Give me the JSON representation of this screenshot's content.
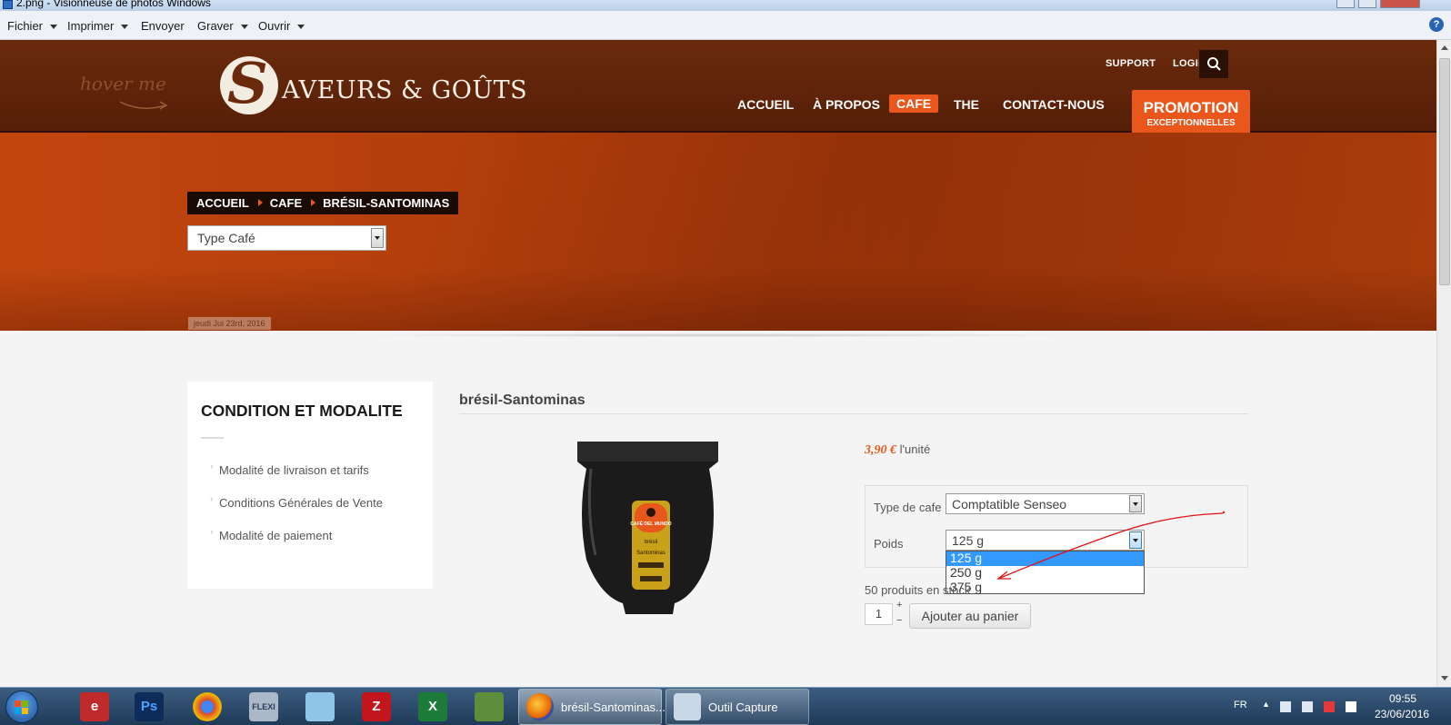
{
  "window": {
    "title": "2.png - Visionneuse de photos Windows"
  },
  "menubar": {
    "items": [
      {
        "label": "Fichier",
        "has_caret": true
      },
      {
        "label": "Imprimer",
        "has_caret": true
      },
      {
        "label": "Envoyer",
        "has_caret": false
      },
      {
        "label": "Graver",
        "has_caret": true
      },
      {
        "label": "Ouvrir",
        "has_caret": true
      }
    ],
    "help": "?"
  },
  "site": {
    "hover_me": "hover me",
    "logo_text": "AVEURS & GOÛTS",
    "top_links": {
      "support": "SUPPORT",
      "login": "LOGIN"
    },
    "nav": [
      {
        "label": "ACCUEIL",
        "active": false
      },
      {
        "label": "À PROPOS",
        "active": false
      },
      {
        "label": "CAFE",
        "active": true
      },
      {
        "label": "THE",
        "active": false
      },
      {
        "label": "CONTACT-NOUS",
        "active": false
      }
    ],
    "promo": {
      "line1": "PROMOTION",
      "line2": "EXCEPTIONNELLES"
    },
    "colors": {
      "accent": "#e9571c",
      "header": "#5a2008",
      "banner": "#b03d0b"
    }
  },
  "banner": {
    "breadcrumb": [
      "ACCUEIL",
      "CAFE",
      "BRÉSIL-SANTOMINAS"
    ],
    "type_select": "Type Café",
    "date": "jeudi Jui 23rd, 2016"
  },
  "sidebar": {
    "title": "CONDITION ET MODALITE",
    "links": [
      "Modalité de livraison et tarifs",
      "Conditions Générales de Vente",
      "Modalité de paiement"
    ]
  },
  "product": {
    "title": "brésil-Santominas",
    "price": "3,90 €",
    "price_unit": "l'unité",
    "bag_label": {
      "brand": "CAFÉ DEL MUNDO",
      "line1": "brésil",
      "line2": "Santominas"
    },
    "type_label": "Type de cafe",
    "type_value": "Comptatible Senseo",
    "weight_label": "Poids",
    "weight_value": "125 g",
    "weight_options": [
      "125 g",
      "250 g",
      "375 g"
    ],
    "weight_selected_index": 0,
    "stock": "50 produits en stock",
    "qty": "1",
    "qty_plus": "+",
    "qty_minus": "−",
    "add_to_cart": "Ajouter au panier"
  },
  "taskbar": {
    "tasks": [
      {
        "label": "brésil-Santominas...",
        "icon": "firefox-icon"
      },
      {
        "label": "Outil Capture",
        "icon": "snipping-tool-icon"
      }
    ],
    "language": "FR",
    "time": "09:55",
    "date": "23/06/2016"
  }
}
